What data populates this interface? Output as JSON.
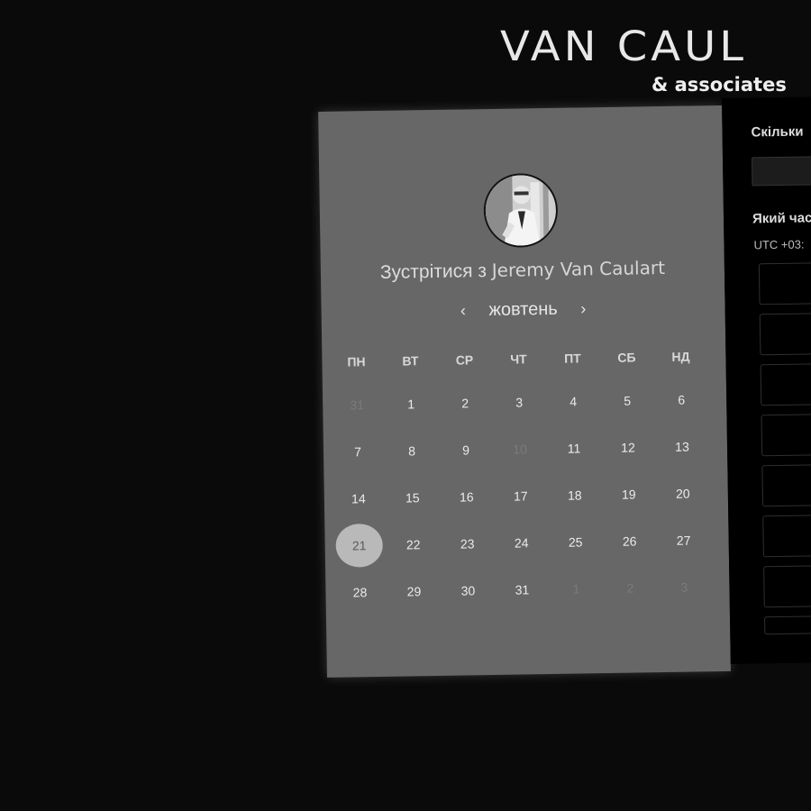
{
  "brand": {
    "title": "VAN CAUL",
    "subtitle": "& associates"
  },
  "booking": {
    "title_prefix": "Зустрітися з",
    "host": "Jeremy Van Caulart",
    "month": "жовтень",
    "prev_icon": "‹",
    "next_icon": "›",
    "weekdays": [
      "ПН",
      "ВТ",
      "СР",
      "ЧТ",
      "ПТ",
      "СБ",
      "НД"
    ],
    "days": [
      {
        "d": "31",
        "muted": true
      },
      {
        "d": "1"
      },
      {
        "d": "2"
      },
      {
        "d": "3"
      },
      {
        "d": "4"
      },
      {
        "d": "5"
      },
      {
        "d": "6"
      },
      {
        "d": "7"
      },
      {
        "d": "8"
      },
      {
        "d": "9"
      },
      {
        "d": "10",
        "muted": true
      },
      {
        "d": "11"
      },
      {
        "d": "12"
      },
      {
        "d": "13"
      },
      {
        "d": "14"
      },
      {
        "d": "15"
      },
      {
        "d": "16"
      },
      {
        "d": "17"
      },
      {
        "d": "18"
      },
      {
        "d": "19"
      },
      {
        "d": "20"
      },
      {
        "d": "21",
        "selected": true
      },
      {
        "d": "22"
      },
      {
        "d": "23"
      },
      {
        "d": "24"
      },
      {
        "d": "25"
      },
      {
        "d": "26"
      },
      {
        "d": "27"
      },
      {
        "d": "28"
      },
      {
        "d": "29"
      },
      {
        "d": "30"
      },
      {
        "d": "31"
      },
      {
        "d": "1",
        "muted": true
      },
      {
        "d": "2",
        "muted": true
      },
      {
        "d": "3",
        "muted": true
      }
    ]
  },
  "side": {
    "duration_question": "Скільки",
    "time_question": "Який час",
    "timezone": "UTC +03:",
    "slot_count": 8
  },
  "colors": {
    "page_bg": "#0a0a0a",
    "card_bg": "#676767",
    "selected_day": "#b9b9b9",
    "side_panel": "#000000"
  }
}
